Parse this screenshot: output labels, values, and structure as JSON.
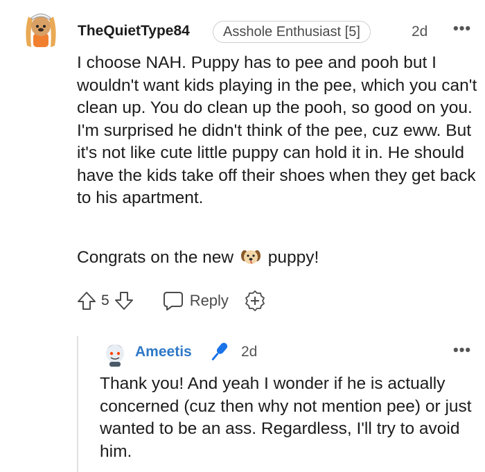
{
  "comment": {
    "username": "TheQuietType84",
    "flair": "Asshole Enthusiast [5]",
    "time": "2d",
    "more": "•••",
    "body": "I choose NAH. Puppy has to pee and pooh but I wouldn't want kids playing in the pee, which you can't clean up. You do clean up the pooh, so good on you. I'm surprised he didn't think of the pee, cuz eww. But it's not like cute little puppy can hold it in. He should have the kids take off their shoes when they get back to his apartment.",
    "congrats_before": "Congrats on the new",
    "congrats_after": "puppy!",
    "votes": "5",
    "reply_label": "Reply",
    "colors": {
      "text": "#1c1c1c",
      "meta": "#555555",
      "icon": "#4a4a4a"
    },
    "icons": [
      "upvote-icon",
      "downvote-icon",
      "reply-icon",
      "award-icon",
      "dog-emoji"
    ]
  },
  "reply": {
    "username": "Ameetis",
    "time": "2d",
    "more": "•••",
    "body": "Thank you! And yeah I wonder if he is actually concerned (cuz then why not mention pee) or just wanted to be an ass. Regardless, I'll try to avoid him.",
    "colors": {
      "username": "#2e78c7",
      "mic": "#1a73e8"
    },
    "icons": [
      "microphone-icon"
    ]
  }
}
